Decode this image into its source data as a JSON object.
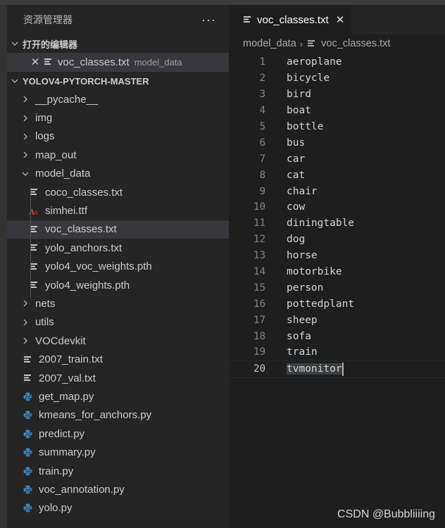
{
  "sidebar": {
    "title": "资源管理器",
    "more_label": "···",
    "open_editors": {
      "label": "打开的编辑器",
      "items": [
        {
          "name": "voc_classes.txt",
          "description": "model_data",
          "icon": "text-file-icon"
        }
      ]
    },
    "project": {
      "label": "YOLOV4-PYTORCH-MASTER",
      "items": [
        {
          "label": "__pycache__",
          "type": "folder",
          "expanded": false,
          "depth": 1
        },
        {
          "label": "img",
          "type": "folder",
          "expanded": false,
          "depth": 1
        },
        {
          "label": "logs",
          "type": "folder",
          "expanded": false,
          "depth": 1
        },
        {
          "label": "map_out",
          "type": "folder",
          "expanded": false,
          "depth": 1
        },
        {
          "label": "model_data",
          "type": "folder",
          "expanded": true,
          "depth": 1
        },
        {
          "label": "coco_classes.txt",
          "type": "text",
          "depth": 2
        },
        {
          "label": "simhei.ttf",
          "type": "font",
          "depth": 2
        },
        {
          "label": "voc_classes.txt",
          "type": "text",
          "depth": 2,
          "selected": true
        },
        {
          "label": "yolo_anchors.txt",
          "type": "text",
          "depth": 2
        },
        {
          "label": "yolo4_voc_weights.pth",
          "type": "text",
          "depth": 2
        },
        {
          "label": "yolo4_weights.pth",
          "type": "text",
          "depth": 2
        },
        {
          "label": "nets",
          "type": "folder",
          "expanded": false,
          "depth": 1
        },
        {
          "label": "utils",
          "type": "folder",
          "expanded": false,
          "depth": 1
        },
        {
          "label": "VOCdevkit",
          "type": "folder",
          "expanded": false,
          "depth": 1
        },
        {
          "label": "2007_train.txt",
          "type": "text",
          "depth": 1
        },
        {
          "label": "2007_val.txt",
          "type": "text",
          "depth": 1
        },
        {
          "label": "get_map.py",
          "type": "python",
          "depth": 1
        },
        {
          "label": "kmeans_for_anchors.py",
          "type": "python",
          "depth": 1
        },
        {
          "label": "predict.py",
          "type": "python",
          "depth": 1
        },
        {
          "label": "summary.py",
          "type": "python",
          "depth": 1
        },
        {
          "label": "train.py",
          "type": "python",
          "depth": 1
        },
        {
          "label": "voc_annotation.py",
          "type": "python",
          "depth": 1
        },
        {
          "label": "yolo.py",
          "type": "python",
          "depth": 1
        }
      ]
    }
  },
  "editor": {
    "tab": {
      "label": "voc_classes.txt",
      "close": "✕"
    },
    "breadcrumb": {
      "folder": "model_data",
      "separator": "›",
      "file": "voc_classes.txt"
    },
    "current_line": 20,
    "lines": [
      "aeroplane",
      "bicycle",
      "bird",
      "boat",
      "bottle",
      "bus",
      "car",
      "cat",
      "chair",
      "cow",
      "diningtable",
      "dog",
      "horse",
      "motorbike",
      "person",
      "pottedplant",
      "sheep",
      "sofa",
      "train",
      "tvmonitor"
    ]
  },
  "colors": {
    "python_icon": "#3b8eca",
    "font_icon": "#cc3e44",
    "selection": "#37373d"
  },
  "watermark": "CSDN @Bubbliiiing"
}
